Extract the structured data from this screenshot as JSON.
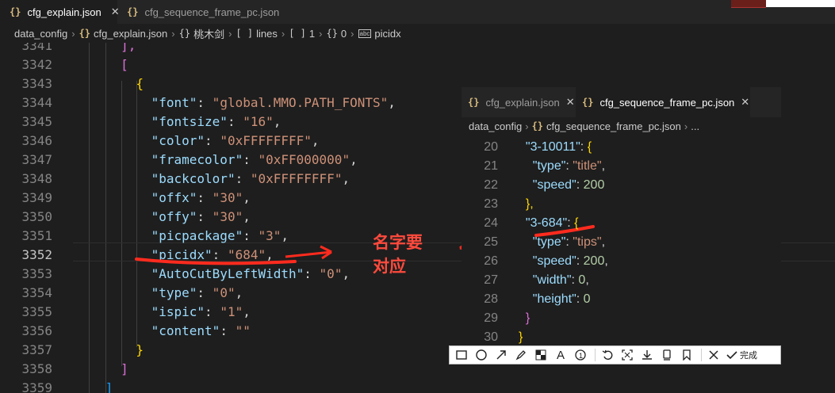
{
  "tabs": [
    {
      "label": "cfg_explain.json",
      "icon": "json-braces-icon",
      "active": true
    },
    {
      "label": "cfg_sequence_frame_pc.json",
      "icon": "json-braces-icon",
      "active": false
    }
  ],
  "breadcrumb": [
    "data_config",
    "cfg_explain.json",
    "桃木剑",
    "lines",
    "1",
    "0",
    "picidx"
  ],
  "main_lines": [
    {
      "n": "3341",
      "text": "],"
    },
    {
      "n": "3342",
      "text": "["
    },
    {
      "n": "3343",
      "text": "{"
    },
    {
      "n": "3344",
      "key": "font",
      "val": "global.MMO.PATH_FONTS"
    },
    {
      "n": "3345",
      "key": "fontsize",
      "val": "16"
    },
    {
      "n": "3346",
      "key": "color",
      "val": "0xFFFFFFFF"
    },
    {
      "n": "3347",
      "key": "framecolor",
      "val": "0xFF000000"
    },
    {
      "n": "3348",
      "key": "backcolor",
      "val": "0xFFFFFFFF"
    },
    {
      "n": "3349",
      "key": "offx",
      "val": "30"
    },
    {
      "n": "3350",
      "key": "offy",
      "val": "30"
    },
    {
      "n": "3351",
      "key": "picpackage",
      "val": "3"
    },
    {
      "n": "3352",
      "key": "picidx",
      "val": "684"
    },
    {
      "n": "3353",
      "key": "AutoCutByLeftWidth",
      "val": "0"
    },
    {
      "n": "3354",
      "key": "type",
      "val": "0"
    },
    {
      "n": "3355",
      "key": "ispic",
      "val": "1"
    },
    {
      "n": "3356",
      "key": "content",
      "val": ""
    },
    {
      "n": "3357",
      "text": "}"
    },
    {
      "n": "3358",
      "text": "]"
    },
    {
      "n": "3359",
      "text": "]"
    }
  ],
  "annotation": {
    "line1": "名字要",
    "line2": "对应",
    "color": "#ff4a3d"
  },
  "overlay": {
    "tabs": [
      {
        "label": "cfg_explain.json",
        "active": false
      },
      {
        "label": "cfg_sequence_frame_pc.json",
        "active": true
      }
    ],
    "breadcrumb": [
      "data_config",
      "cfg_sequence_frame_pc.json",
      "..."
    ],
    "lines": [
      {
        "n": "20",
        "key": "3-10011"
      },
      {
        "n": "21",
        "key": "type",
        "val": "title"
      },
      {
        "n": "22",
        "key": "speed",
        "num": "200"
      },
      {
        "n": "23",
        "text": "},"
      },
      {
        "n": "24",
        "key": "3-684"
      },
      {
        "n": "25",
        "key": "type",
        "val": "tips"
      },
      {
        "n": "26",
        "key": "speed",
        "num": "200"
      },
      {
        "n": "27",
        "key": "width",
        "num": "0"
      },
      {
        "n": "28",
        "key": "height",
        "num": "0"
      },
      {
        "n": "29",
        "text": "}"
      },
      {
        "n": "30",
        "text": "}"
      }
    ]
  },
  "toolbar": {
    "tools": [
      "rectangle-icon",
      "ellipse-icon",
      "arrow-icon",
      "pen-icon",
      "mosaic-icon",
      "text-icon",
      "number-icon",
      "undo-icon",
      "crop-icon",
      "download-icon",
      "pin-icon",
      "bookmark-icon",
      "cancel-icon",
      "confirm-icon"
    ],
    "done_label": "完成"
  },
  "colors": {
    "key": "#9cdcfe",
    "string": "#ce9178",
    "number": "#b5cea8",
    "bracket1": "#ffd700",
    "bracket2": "#da70d6",
    "bracket3": "#179fff"
  }
}
